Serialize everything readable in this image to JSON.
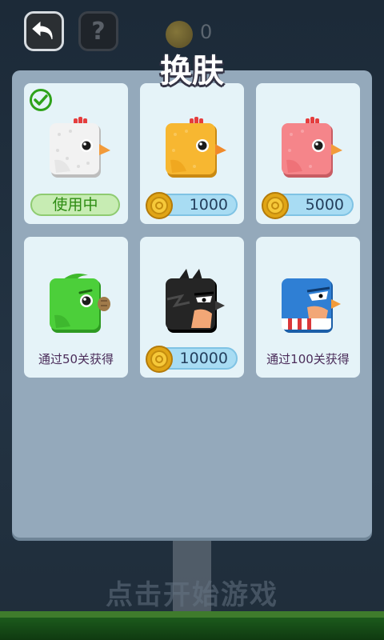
{
  "title": "换肤",
  "header": {
    "coin_count": "0"
  },
  "footer": {
    "start_text": "点击开始游戏"
  },
  "skins": [
    {
      "status": "使用中",
      "selected": true,
      "color": "#f2f2f2"
    },
    {
      "price": "1000",
      "color": "#f7b731"
    },
    {
      "price": "5000",
      "color": "#f5858a"
    },
    {
      "unlock_text": "通过50关获得",
      "color": "#4ccf3a"
    },
    {
      "price": "10000",
      "color": "#1f1f1f"
    },
    {
      "unlock_text": "通过100关获得",
      "color": "#2f7fd4"
    }
  ],
  "icons": [
    "back-arrow-icon",
    "question-mark-icon",
    "coin-icon",
    "check-icon"
  ]
}
